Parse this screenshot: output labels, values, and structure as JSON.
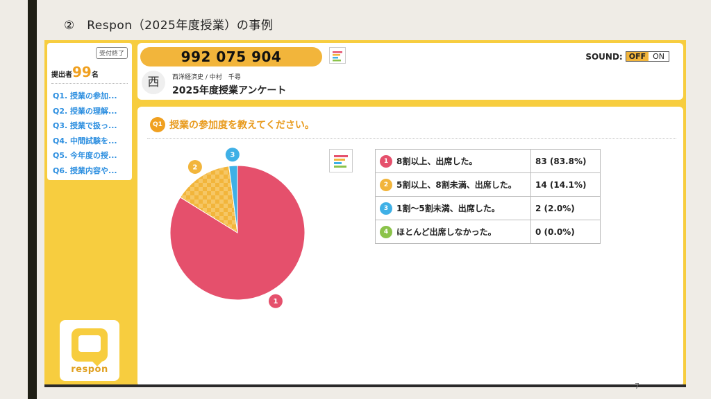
{
  "slide": {
    "title": "②　Respon（2025年度授業）の事例",
    "page_number": "7"
  },
  "sidebar": {
    "closed_badge": "受付終了",
    "submitters_label": "提出者",
    "submitters_count": "99",
    "submitters_suffix": "名",
    "questions": [
      {
        "label": "Q1. 授業の参加..."
      },
      {
        "label": "Q2. 授業の理解..."
      },
      {
        "label": "Q3. 授業で扱っ..."
      },
      {
        "label": "Q4. 中間試験を..."
      },
      {
        "label": "Q5. 今年度の授..."
      },
      {
        "label": "Q6. 授業内容や..."
      }
    ],
    "logo_text": "respon"
  },
  "header": {
    "code": "992 075 904",
    "sound_label": "SOUND:",
    "sound_off": "OFF",
    "sound_on": "ON",
    "avatar": "西",
    "course": "西洋経済史 / 中村　千尋",
    "title": "2025年度授業アンケート"
  },
  "question": {
    "badge": "Q1",
    "text": "授業の参加度を教えてください。"
  },
  "colors": {
    "accent": "#f7cd3f",
    "option1": "#e5506c",
    "option2": "#f2b53b",
    "option3": "#3fb0e6",
    "option4": "#8bc34a"
  },
  "chart_data": {
    "type": "pie",
    "categories": [
      "8割以上、出席した。",
      "5割以上、8割未満、出席した。",
      "1割〜5割未満、出席した。",
      "ほとんど出席しなかった。"
    ],
    "values": [
      83,
      14,
      2,
      0
    ],
    "percent": [
      83.8,
      14.1,
      2.0,
      0.0
    ],
    "colors": [
      "#e5506c",
      "#f2b53b",
      "#3fb0e6",
      "#8bc34a"
    ],
    "slice_labels": [
      "1",
      "2",
      "3"
    ]
  },
  "results": [
    {
      "num": "1",
      "label": "8割以上、出席した。",
      "value": "83 (83.8%)"
    },
    {
      "num": "2",
      "label": "5割以上、8割未満、出席した。",
      "value": "14 (14.1%)"
    },
    {
      "num": "3",
      "label": "1割〜5割未満、出席した。",
      "value": "2 (2.0%)"
    },
    {
      "num": "4",
      "label": "ほとんど出席しなかった。",
      "value": "0 (0.0%)"
    }
  ]
}
